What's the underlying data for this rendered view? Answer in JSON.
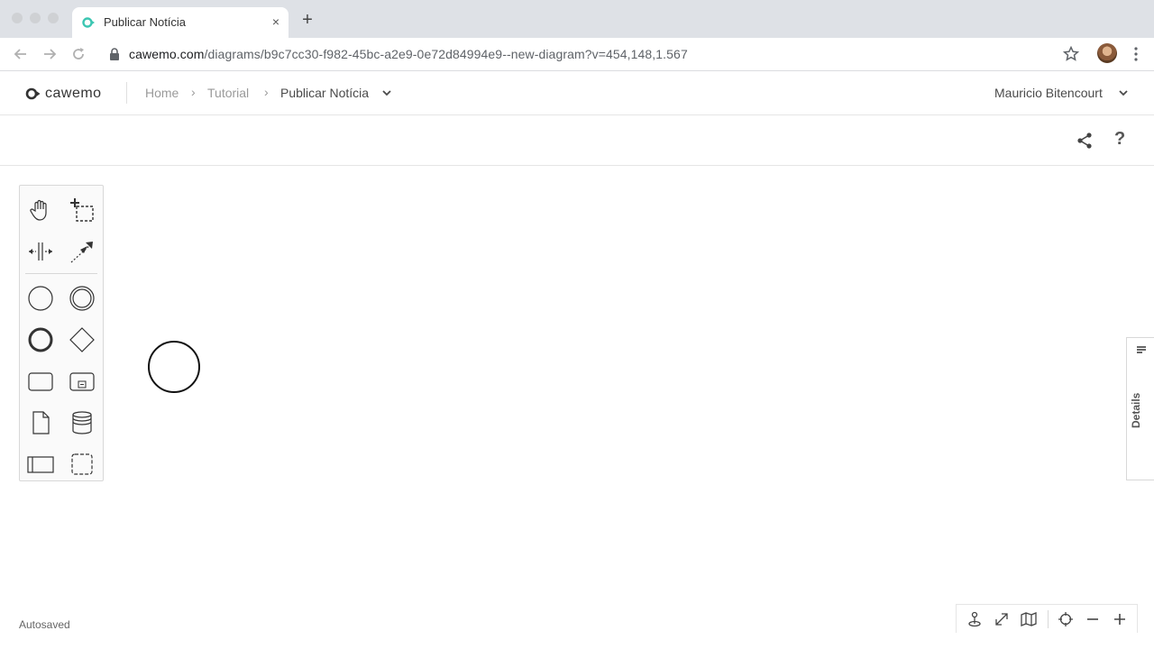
{
  "browser": {
    "tab_title": "Publicar Notícia",
    "tab_close": "×",
    "new_tab": "+",
    "url_host": "cawemo.com",
    "url_path": "/diagrams/b9c7cc30-f982-45bc-a2e9-0e72d84994e9--new-diagram?v=454,148,1.567"
  },
  "header": {
    "logo_text": "cawemo",
    "breadcrumbs": [
      "Home",
      "Tutorial",
      "Publicar Notícia"
    ],
    "crumb_separator": "›",
    "user_name": "Mauricio Bitencourt"
  },
  "toolbar": {
    "help": "?"
  },
  "details": {
    "label": "Details"
  },
  "status": {
    "autosaved": "Autosaved"
  },
  "palette": {
    "tools": [
      "hand-tool",
      "lasso-tool",
      "space-tool",
      "global-connect-tool",
      "start-event",
      "intermediate-event",
      "end-event",
      "gateway",
      "task",
      "subprocess",
      "data-object",
      "data-store",
      "pool",
      "group"
    ]
  },
  "colors": {
    "accent": "#3cc6b2",
    "chrome_bg": "#dee1e6"
  }
}
